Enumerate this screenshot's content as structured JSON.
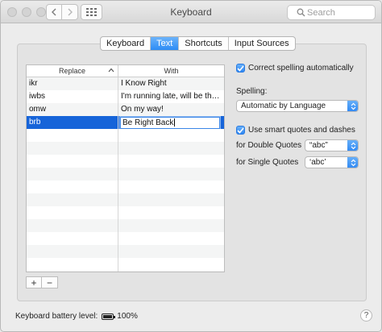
{
  "window": {
    "title": "Keyboard",
    "search_placeholder": "Search"
  },
  "tabs": [
    {
      "label": "Keyboard",
      "active": false
    },
    {
      "label": "Text",
      "active": true
    },
    {
      "label": "Shortcuts",
      "active": false
    },
    {
      "label": "Input Sources",
      "active": false
    }
  ],
  "table": {
    "col_replace": "Replace",
    "col_with": "With",
    "rows": [
      {
        "replace": "ikr",
        "with": "I Know Right"
      },
      {
        "replace": "iwbs",
        "with": "I'm running late, will be there soon!"
      },
      {
        "replace": "omw",
        "with": "On my way!"
      },
      {
        "replace": "brb",
        "with": "Be Right Back",
        "selected": true
      }
    ]
  },
  "buttons": {
    "add": "+",
    "remove": "−"
  },
  "options": {
    "correct_spelling": "Correct spelling automatically",
    "spelling_label": "Spelling:",
    "spelling_value": "Automatic by Language",
    "smart_quotes": "Use smart quotes and dashes",
    "double_quotes_label": "for Double Quotes",
    "double_quotes_value": "“abc”",
    "single_quotes_label": "for Single Quotes",
    "single_quotes_value": "‘abc’"
  },
  "footer": {
    "battery_label": "Keyboard battery level:",
    "battery_level": "100%",
    "battery_fraction": 1.0,
    "help": "?"
  },
  "colors": {
    "accent": "#2d8cf5",
    "selection": "#1664d9"
  }
}
